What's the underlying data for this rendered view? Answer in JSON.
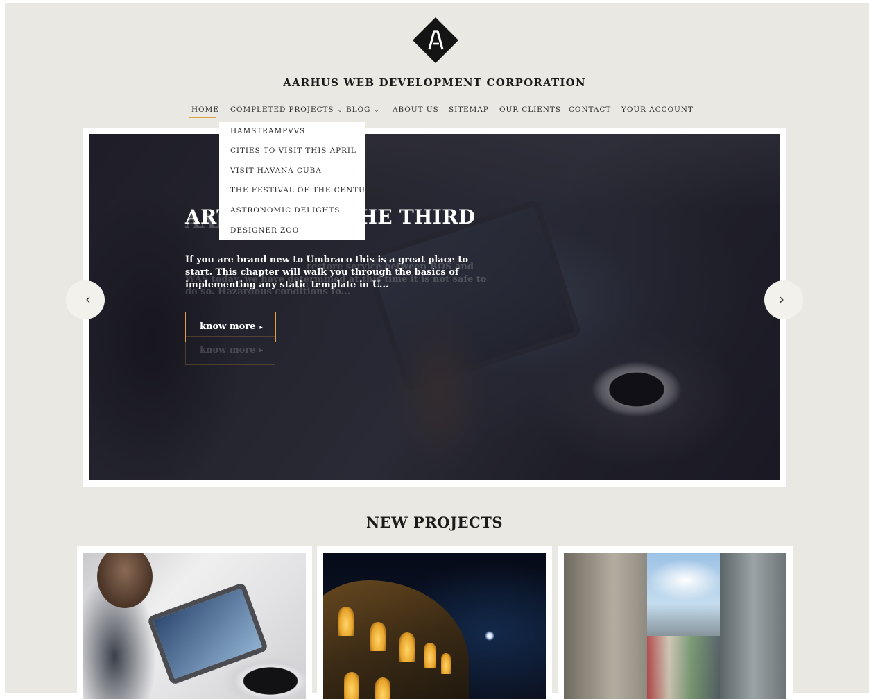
{
  "site": {
    "logo_icon": "A-diamond-logo-icon",
    "title": "AARHUS WEB DEVELOPMENT CORPORATION"
  },
  "nav": {
    "items": [
      {
        "label": "HOME",
        "active": true
      },
      {
        "label": "COMPLETED PROJECTS",
        "has_dropdown": true
      },
      {
        "label": "BLOG",
        "has_dropdown": true
      },
      {
        "label": "ABOUT US"
      },
      {
        "label": "SITEMAP"
      },
      {
        "label": "OUR CLIENTS"
      },
      {
        "label": "CONTACT"
      },
      {
        "label": "YOUR ACCOUNT"
      }
    ],
    "chevron": "⌄",
    "accent_color": "#e0a040"
  },
  "dropdown": {
    "items": [
      "HAMSTRAMPVVS",
      "CITIES TO VISIT THIS APRIL",
      "VISIT HAVANA CUBA",
      "THE FESTIVAL OF THE CENTURY",
      "ASTRONOMIC DELIGHTS",
      "DESIGNER ZOO"
    ]
  },
  "slider": {
    "title": "ARTICLES OF THE THIRD",
    "text": "If you are brand new to Umbraco this is a great place to start. This chapter will walk you through the basics of implementing any static template in U...",
    "button_label": "know more",
    "button_icon": "▸",
    "ghost": {
      "title": "AARHUS",
      "text": "restore service between BOS and WAS today, we have determined at this time it is not safe to do so. Hazardous conditions fo...",
      "button_label": "know more ▸"
    },
    "prev_icon": "‹",
    "next_icon": "›"
  },
  "projects": {
    "heading": "NEW PROJECTS"
  }
}
